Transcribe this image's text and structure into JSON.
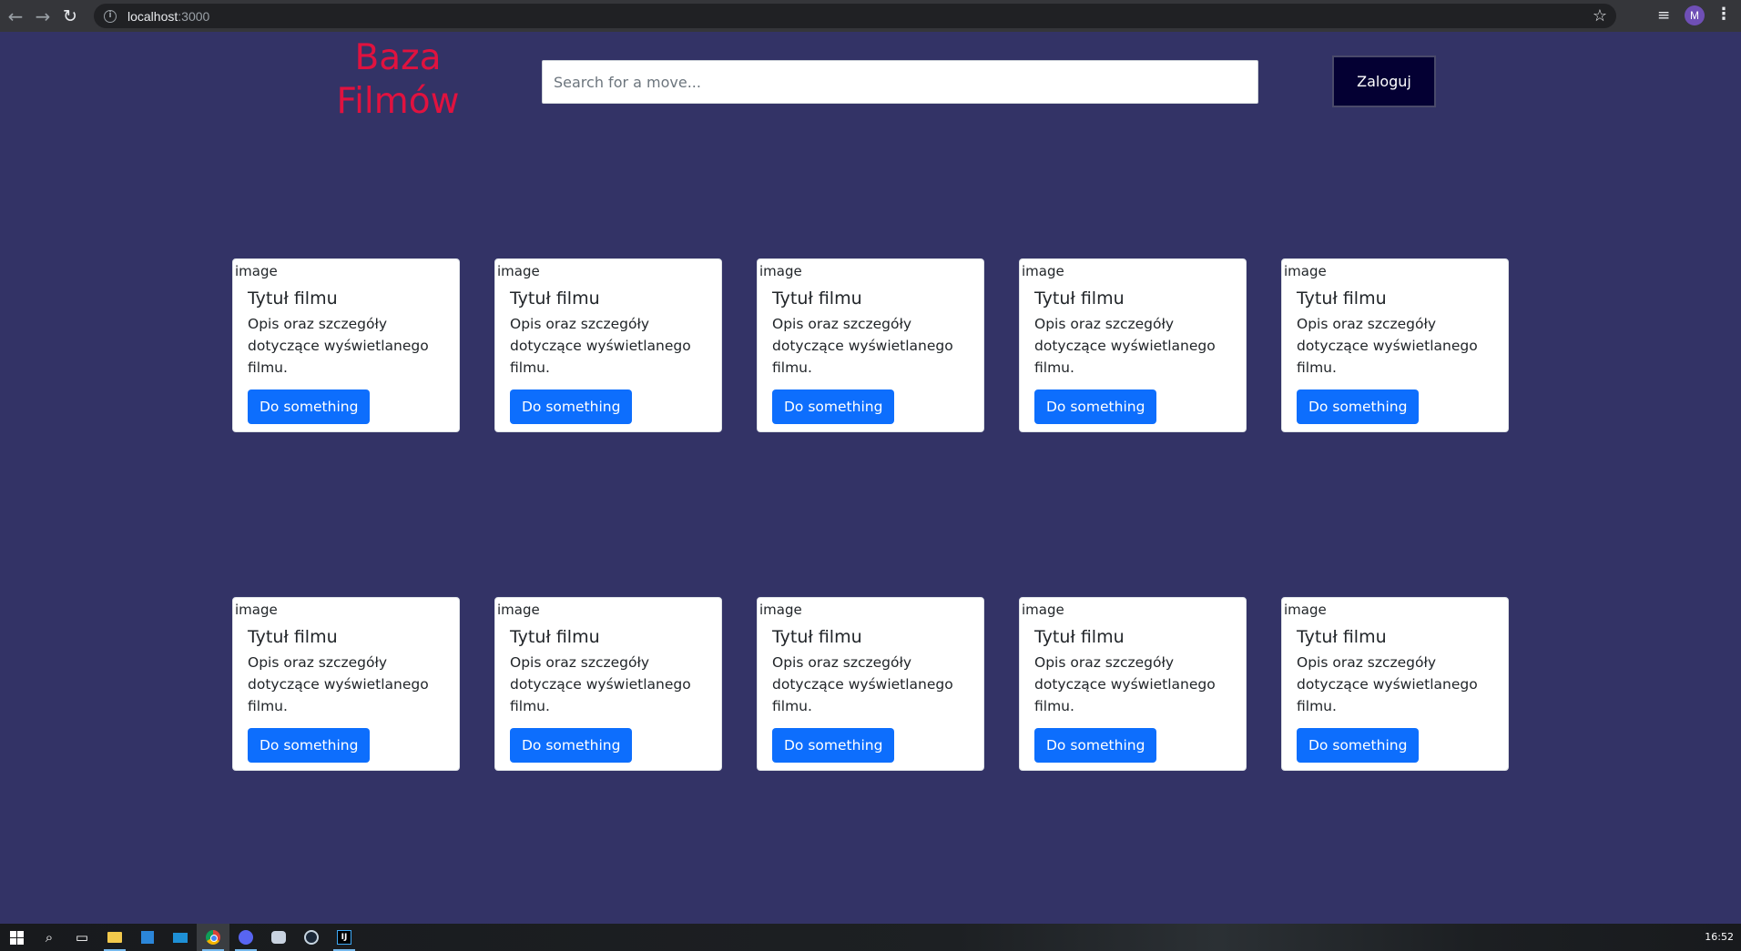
{
  "browser": {
    "url_host": "localhost",
    "url_port": ":3000",
    "profile_initial": "M",
    "icons": {
      "back": "back-arrow-icon",
      "forward": "forward-arrow-icon",
      "reload": "reload-icon",
      "info": "info-icon",
      "bookmark": "star-icon",
      "media": "playlist-icon",
      "menu": "kebab-menu-icon"
    }
  },
  "header": {
    "logo_line1": "Baza",
    "logo_line2": "Filmów",
    "logo_color": "#e0123f",
    "search_placeholder": "Search for a move...",
    "login_label": "Zaloguj"
  },
  "cards": [
    {
      "image_alt": "image",
      "title": "Tytuł filmu",
      "text": "Opis oraz szczegóły dotyczące wyświetlanego filmu.",
      "button": "Do something"
    },
    {
      "image_alt": "image",
      "title": "Tytuł filmu",
      "text": "Opis oraz szczegóły dotyczące wyświetlanego filmu.",
      "button": "Do something"
    },
    {
      "image_alt": "image",
      "title": "Tytuł filmu",
      "text": "Opis oraz szczegóły dotyczące wyświetlanego filmu.",
      "button": "Do something"
    },
    {
      "image_alt": "image",
      "title": "Tytuł filmu",
      "text": "Opis oraz szczegóły dotyczące wyświetlanego filmu.",
      "button": "Do something"
    },
    {
      "image_alt": "image",
      "title": "Tytuł filmu",
      "text": "Opis oraz szczegóły dotyczące wyświetlanego filmu.",
      "button": "Do something"
    },
    {
      "image_alt": "image",
      "title": "Tytuł filmu",
      "text": "Opis oraz szczegóły dotyczące wyświetlanego filmu.",
      "button": "Do something"
    },
    {
      "image_alt": "image",
      "title": "Tytuł filmu",
      "text": "Opis oraz szczegóły dotyczące wyświetlanego filmu.",
      "button": "Do something"
    },
    {
      "image_alt": "image",
      "title": "Tytuł filmu",
      "text": "Opis oraz szczegóły dotyczące wyświetlanego filmu.",
      "button": "Do something"
    },
    {
      "image_alt": "image",
      "title": "Tytuł filmu",
      "text": "Opis oraz szczegóły dotyczące wyświetlanego filmu.",
      "button": "Do something"
    },
    {
      "image_alt": "image",
      "title": "Tytuł filmu",
      "text": "Opis oraz szczegóły dotyczące wyświetlanego filmu.",
      "button": "Do something"
    }
  ],
  "colors": {
    "page_background": "#333366",
    "card_button": "#0d6efd",
    "login_button": "#040033"
  },
  "taskbar": {
    "clock": "16:52",
    "apps": [
      "start-windows-icon",
      "search-icon",
      "task-view-icon",
      "file-explorer-icon",
      "store-icon",
      "mail-icon",
      "chrome-icon",
      "discord-icon",
      "game-launcher-icon",
      "steam-icon",
      "intellij-icon"
    ]
  }
}
